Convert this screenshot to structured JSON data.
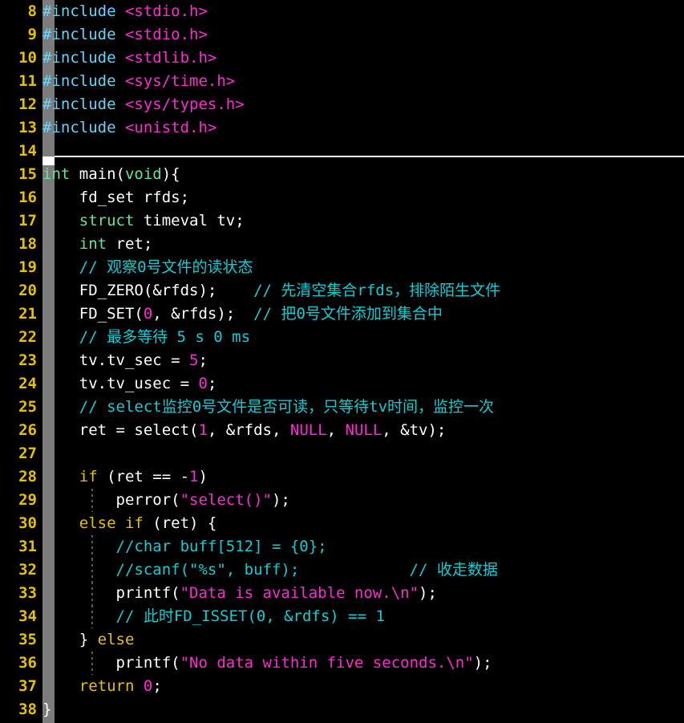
{
  "app": {
    "kind": "terminal-text-editor",
    "language": "c",
    "colors": {
      "background": "#000000",
      "foreground": "#ffffff",
      "line_number": "#e5c100",
      "preprocessor": "#5fd7ff",
      "header_name": "#ff2ad4",
      "type_keyword": "#60e69a",
      "control_keyword": "#e5c100",
      "comment": "#11cdd4",
      "number": "#ff2ad4",
      "constant": "#ff2ad4",
      "string": "#ff2ad4",
      "fold_column": "#7c7c7c",
      "fold_marker": "#ffffff",
      "indent_guide": "#5a5a5a"
    }
  },
  "editor": {
    "first_visible_line": 8,
    "last_visible_line": 38,
    "cursor_line": 15,
    "cursor_column": 1,
    "fold_rule_above_line": 15
  },
  "lines": [
    {
      "no": "8",
      "indent_guides": [],
      "tokens": [
        {
          "text": "#include ",
          "cls": "t-preproc"
        },
        {
          "text": "<stdio.h>",
          "cls": "t-header"
        }
      ]
    },
    {
      "no": "9",
      "indent_guides": [],
      "tokens": [
        {
          "text": "#include ",
          "cls": "t-preproc"
        },
        {
          "text": "<stdio.h>",
          "cls": "t-header"
        }
      ]
    },
    {
      "no": "10",
      "indent_guides": [],
      "tokens": [
        {
          "text": "#include ",
          "cls": "t-preproc"
        },
        {
          "text": "<stdlib.h>",
          "cls": "t-header"
        }
      ]
    },
    {
      "no": "11",
      "indent_guides": [],
      "tokens": [
        {
          "text": "#include ",
          "cls": "t-preproc"
        },
        {
          "text": "<sys/time.h>",
          "cls": "t-header"
        }
      ]
    },
    {
      "no": "12",
      "indent_guides": [],
      "tokens": [
        {
          "text": "#include ",
          "cls": "t-preproc"
        },
        {
          "text": "<sys/types.h>",
          "cls": "t-header"
        }
      ]
    },
    {
      "no": "13",
      "indent_guides": [],
      "tokens": [
        {
          "text": "#include ",
          "cls": "t-preproc"
        },
        {
          "text": "<unistd.h>",
          "cls": "t-header"
        }
      ]
    },
    {
      "no": "14",
      "indent_guides": [],
      "tokens": []
    },
    {
      "no": "15",
      "indent_guides": [],
      "tokens": [
        {
          "text": "int",
          "cls": "t-type"
        },
        {
          "text": " main(",
          "cls": "t-plain"
        },
        {
          "text": "void",
          "cls": "t-type"
        },
        {
          "text": "){",
          "cls": "t-plain"
        }
      ]
    },
    {
      "no": "16",
      "indent_guides": [],
      "tokens": [
        {
          "text": "    fd_set rfds;",
          "cls": "t-plain"
        }
      ]
    },
    {
      "no": "17",
      "indent_guides": [],
      "tokens": [
        {
          "text": "    ",
          "cls": "t-plain"
        },
        {
          "text": "struct",
          "cls": "t-type"
        },
        {
          "text": " timeval tv;",
          "cls": "t-plain"
        }
      ]
    },
    {
      "no": "18",
      "indent_guides": [],
      "tokens": [
        {
          "text": "    ",
          "cls": "t-plain"
        },
        {
          "text": "int",
          "cls": "t-type"
        },
        {
          "text": " ret;",
          "cls": "t-plain"
        }
      ]
    },
    {
      "no": "19",
      "indent_guides": [],
      "tokens": [
        {
          "text": "    ",
          "cls": "t-plain"
        },
        {
          "text": "// 观察0号文件的读状态",
          "cls": "t-comment"
        }
      ]
    },
    {
      "no": "20",
      "indent_guides": [],
      "tokens": [
        {
          "text": "    FD_ZERO(&rfds);    ",
          "cls": "t-plain"
        },
        {
          "text": "// 先清空集合rfds，排除陌生文件",
          "cls": "t-comment"
        }
      ]
    },
    {
      "no": "21",
      "indent_guides": [],
      "tokens": [
        {
          "text": "    FD_SET(",
          "cls": "t-plain"
        },
        {
          "text": "0",
          "cls": "t-number"
        },
        {
          "text": ", &rfds);  ",
          "cls": "t-plain"
        },
        {
          "text": "// 把0号文件添加到集合中",
          "cls": "t-comment"
        }
      ]
    },
    {
      "no": "22",
      "indent_guides": [],
      "tokens": [
        {
          "text": "    ",
          "cls": "t-plain"
        },
        {
          "text": "// 最多等待 5 s 0 ms",
          "cls": "t-comment"
        }
      ]
    },
    {
      "no": "23",
      "indent_guides": [],
      "tokens": [
        {
          "text": "    tv.tv_sec = ",
          "cls": "t-plain"
        },
        {
          "text": "5",
          "cls": "t-number"
        },
        {
          "text": ";",
          "cls": "t-plain"
        }
      ]
    },
    {
      "no": "24",
      "indent_guides": [],
      "tokens": [
        {
          "text": "    tv.tv_usec = ",
          "cls": "t-plain"
        },
        {
          "text": "0",
          "cls": "t-number"
        },
        {
          "text": ";",
          "cls": "t-plain"
        }
      ]
    },
    {
      "no": "25",
      "indent_guides": [],
      "tokens": [
        {
          "text": "    ",
          "cls": "t-plain"
        },
        {
          "text": "// select监控0号文件是否可读，只等待tv时间，监控一次",
          "cls": "t-comment"
        }
      ]
    },
    {
      "no": "26",
      "indent_guides": [],
      "tokens": [
        {
          "text": "    ret = select(",
          "cls": "t-plain"
        },
        {
          "text": "1",
          "cls": "t-number"
        },
        {
          "text": ", &rfds, ",
          "cls": "t-plain"
        },
        {
          "text": "NULL",
          "cls": "t-const"
        },
        {
          "text": ", ",
          "cls": "t-plain"
        },
        {
          "text": "NULL",
          "cls": "t-const"
        },
        {
          "text": ", &tv);",
          "cls": "t-plain"
        }
      ]
    },
    {
      "no": "27",
      "indent_guides": [],
      "tokens": []
    },
    {
      "no": "28",
      "indent_guides": [],
      "tokens": [
        {
          "text": "    ",
          "cls": "t-plain"
        },
        {
          "text": "if",
          "cls": "t-keyword"
        },
        {
          "text": " (ret == -",
          "cls": "t-plain"
        },
        {
          "text": "1",
          "cls": "t-number"
        },
        {
          "text": ")",
          "cls": "t-plain"
        }
      ]
    },
    {
      "no": "29",
      "indent_guides": [
        "g4"
      ],
      "tokens": [
        {
          "text": "        perror(",
          "cls": "t-plain"
        },
        {
          "text": "\"select()\"",
          "cls": "t-string"
        },
        {
          "text": ");",
          "cls": "t-plain"
        }
      ]
    },
    {
      "no": "30",
      "indent_guides": [],
      "tokens": [
        {
          "text": "    ",
          "cls": "t-plain"
        },
        {
          "text": "else if",
          "cls": "t-keyword"
        },
        {
          "text": " (ret) {",
          "cls": "t-plain"
        }
      ]
    },
    {
      "no": "31",
      "indent_guides": [
        "g4"
      ],
      "tokens": [
        {
          "text": "        //char buff[512] = {0};",
          "cls": "t-comment"
        }
      ]
    },
    {
      "no": "32",
      "indent_guides": [
        "g4"
      ],
      "tokens": [
        {
          "text": "        //scanf(\"%s\", buff);            // 收走数据",
          "cls": "t-comment"
        }
      ]
    },
    {
      "no": "33",
      "indent_guides": [
        "g4"
      ],
      "tokens": [
        {
          "text": "        printf(",
          "cls": "t-plain"
        },
        {
          "text": "\"Data is available now.\\n\"",
          "cls": "t-string"
        },
        {
          "text": ");",
          "cls": "t-plain"
        }
      ]
    },
    {
      "no": "34",
      "indent_guides": [
        "g4"
      ],
      "tokens": [
        {
          "text": "        // 此时FD_ISSET(0, &rdfs) == 1",
          "cls": "t-comment"
        }
      ]
    },
    {
      "no": "35",
      "indent_guides": [],
      "tokens": [
        {
          "text": "    } ",
          "cls": "t-plain"
        },
        {
          "text": "else",
          "cls": "t-keyword"
        }
      ]
    },
    {
      "no": "36",
      "indent_guides": [
        "g4"
      ],
      "tokens": [
        {
          "text": "        printf(",
          "cls": "t-plain"
        },
        {
          "text": "\"No data within five seconds.\\n\"",
          "cls": "t-string"
        },
        {
          "text": ");",
          "cls": "t-plain"
        }
      ]
    },
    {
      "no": "37",
      "indent_guides": [],
      "tokens": [
        {
          "text": "    ",
          "cls": "t-plain"
        },
        {
          "text": "return",
          "cls": "t-keyword"
        },
        {
          "text": " ",
          "cls": "t-plain"
        },
        {
          "text": "0",
          "cls": "t-number"
        },
        {
          "text": ";",
          "cls": "t-plain"
        }
      ]
    },
    {
      "no": "38",
      "indent_guides": [],
      "tokens": [
        {
          "text": "}",
          "cls": "t-plain"
        }
      ]
    }
  ]
}
